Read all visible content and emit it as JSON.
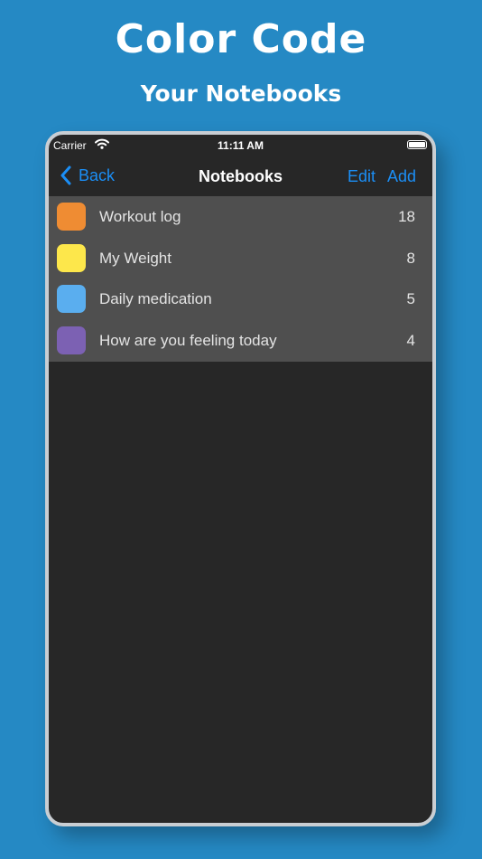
{
  "promo": {
    "headline": "Color Code",
    "subheadline": "Your Notebooks"
  },
  "status_bar": {
    "carrier": "Carrier",
    "time": "11:11 AM"
  },
  "nav_bar": {
    "back_label": "Back",
    "title": "Notebooks",
    "edit_label": "Edit",
    "add_label": "Add"
  },
  "notebooks": [
    {
      "title": "Workout log",
      "count": "18",
      "color": "#ef8c33"
    },
    {
      "title": "My Weight",
      "count": "8",
      "color": "#fde74b"
    },
    {
      "title": "Daily medication",
      "count": "5",
      "color": "#5aaeef"
    },
    {
      "title": "How are you feeling today",
      "count": "4",
      "color": "#7c61b3"
    }
  ],
  "colors": {
    "background": "#2589c4",
    "screen": "#272727",
    "list_background": "#4f4f4f",
    "accent": "#1b8ef5"
  },
  "icons": [
    "wifi-icon",
    "battery-icon",
    "chevron-left-icon"
  ]
}
